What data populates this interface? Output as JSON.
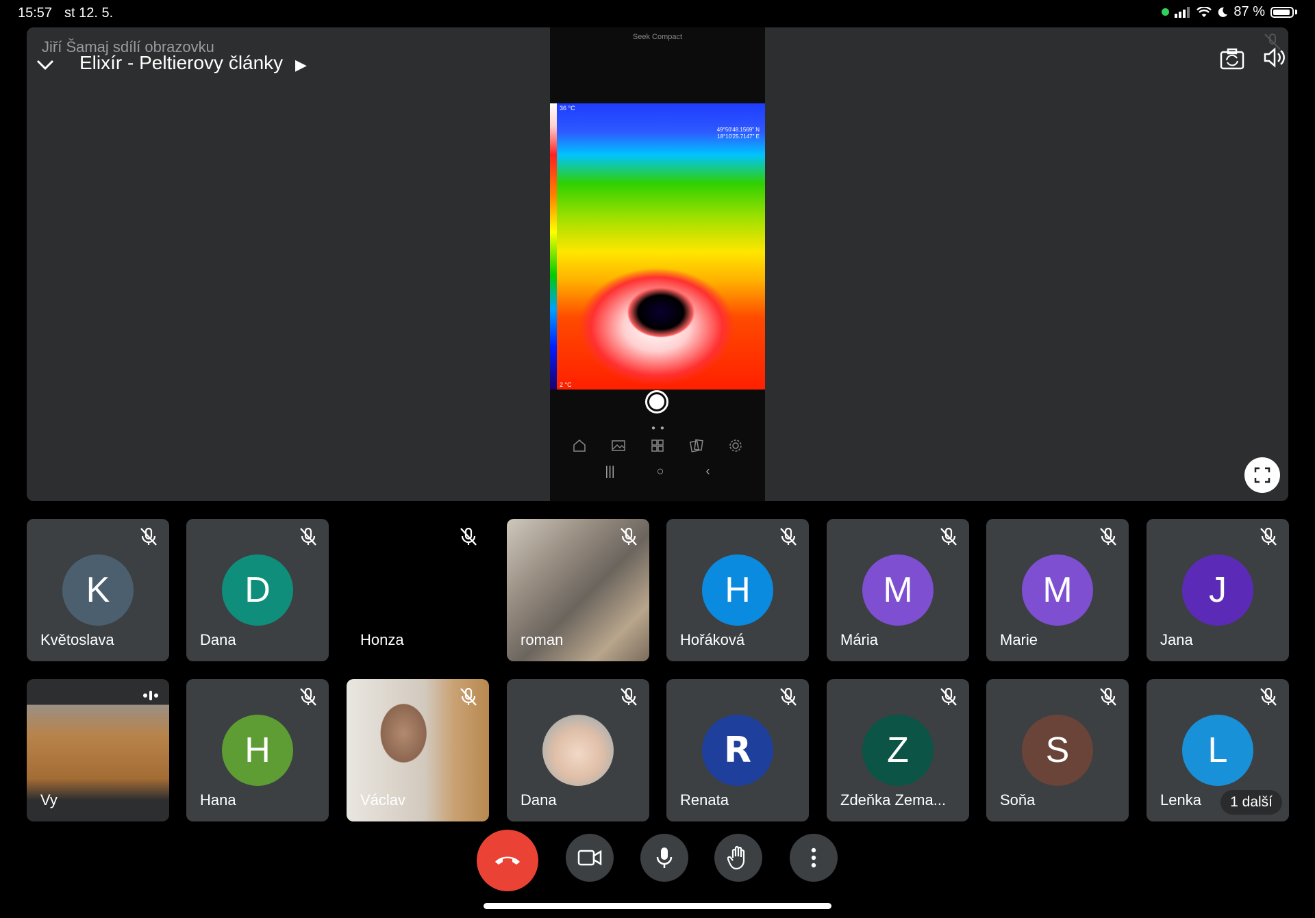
{
  "status_bar": {
    "time": "15:57",
    "date": "st 12. 5.",
    "battery": "87 %"
  },
  "stage": {
    "presenter": "Jiří Šamaj sdílí obrazovku",
    "meeting_title": "Elixír - Peltierovy články",
    "phone": {
      "brand": "Seek Compact",
      "temp_high": "36 °C",
      "temp_low": "2 °C",
      "coord_1": "49°50'48.1569\" N",
      "coord_2": "18°10'25.7147\" E"
    }
  },
  "participants": [
    {
      "name": "Květoslava",
      "initial": "K",
      "color": "#4b5f6e",
      "kind": "avatar"
    },
    {
      "name": "Dana",
      "initial": "D",
      "color": "#0f8f7b",
      "kind": "avatar"
    },
    {
      "name": "Honza",
      "initial": "",
      "color": "#000000",
      "kind": "video-off"
    },
    {
      "name": "roman",
      "initial": "",
      "color": "",
      "kind": "video"
    },
    {
      "name": "Hořáková",
      "initial": "H",
      "color": "#0b8be0",
      "kind": "avatar"
    },
    {
      "name": "Mária",
      "initial": "M",
      "color": "#7e4fd1",
      "kind": "avatar"
    },
    {
      "name": "Marie",
      "initial": "M",
      "color": "#7e4fd1",
      "kind": "avatar"
    },
    {
      "name": "Jana",
      "initial": "J",
      "color": "#5b2bb8",
      "kind": "avatar"
    },
    {
      "name": "Vy",
      "initial": "",
      "color": "",
      "kind": "video-self"
    },
    {
      "name": "Hana",
      "initial": "H",
      "color": "#5e9d33",
      "kind": "avatar"
    },
    {
      "name": "Václav",
      "initial": "",
      "color": "",
      "kind": "video"
    },
    {
      "name": "Dana",
      "initial": "",
      "color": "",
      "kind": "photo"
    },
    {
      "name": "Renata",
      "initial": "R",
      "color": "#1f3f9c",
      "kind": "logo"
    },
    {
      "name": "Zdeňka Zema...",
      "initial": "Z",
      "color": "#0b5446",
      "kind": "avatar"
    },
    {
      "name": "Soňa",
      "initial": "S",
      "color": "#6a4438",
      "kind": "avatar"
    },
    {
      "name": "Lenka",
      "initial": "L",
      "color": "#1891d8",
      "kind": "avatar"
    }
  ],
  "more_participants": "1 další",
  "icons": {
    "collapse": "chevron-down-icon",
    "flip": "camera-flip-icon",
    "speaker": "speaker-icon",
    "mute": "mic-off-icon",
    "fullscreen": "fullscreen-icon",
    "end": "end-call-icon",
    "camera": "camera-icon",
    "mic": "mic-icon",
    "hand": "raise-hand-icon",
    "more": "more-vert-icon"
  }
}
